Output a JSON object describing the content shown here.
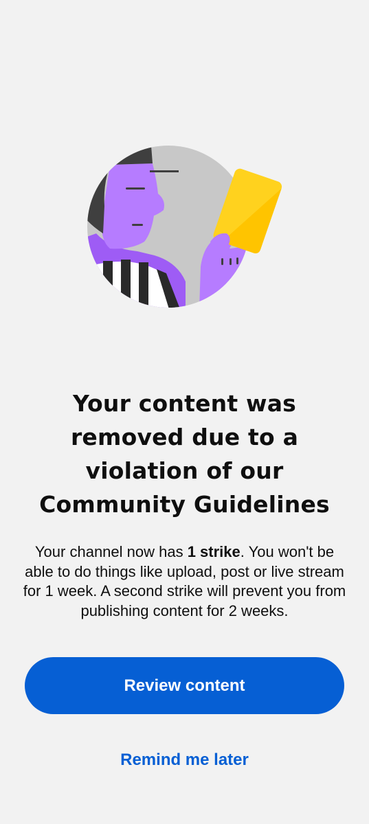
{
  "illustration": {
    "icon": "referee-yellow-card-icon",
    "colors": {
      "circle": "#c8c8c8",
      "skin": "#b67cff",
      "skin_shadow": "#9e5cf5",
      "hair": "#3f3f3f",
      "card": "#ffd21e",
      "card_shadow": "#ffc400",
      "stripe_dark": "#2a2a2a",
      "stripe_light": "#ffffff"
    }
  },
  "dialog": {
    "title": "Your content was removed due to a violation of our Community Guidelines",
    "body_before": "Your channel now has ",
    "body_strong": "1 strike",
    "body_after": ". You won't be able to do things like upload, post or live stream for 1 week. A second strike will prevent you from publishing content for 2 weeks."
  },
  "actions": {
    "primary_label": "Review content",
    "secondary_label": "Remind me later"
  },
  "theme": {
    "background": "#f2f2f2",
    "accent": "#065fd4",
    "text": "#0f0f0f"
  }
}
